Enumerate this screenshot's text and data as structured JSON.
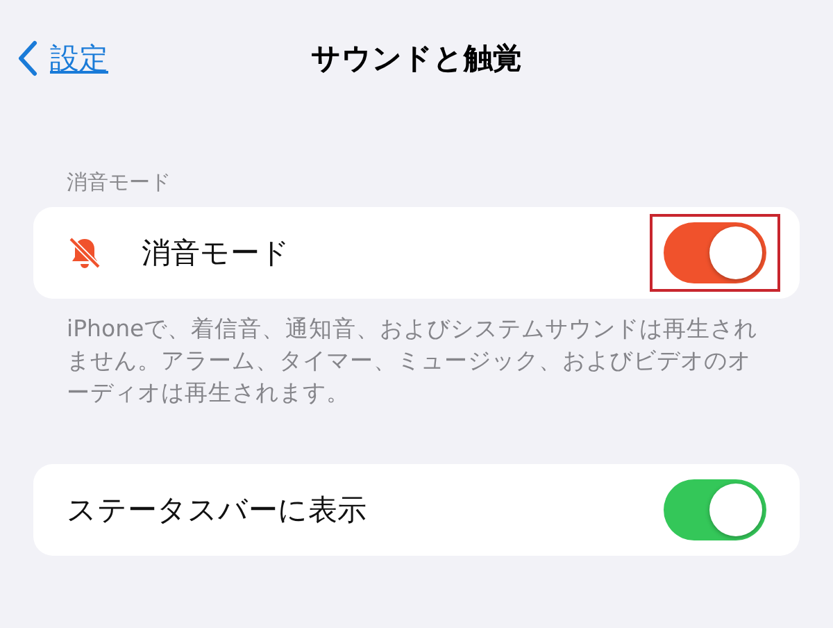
{
  "nav": {
    "back_label": "設定",
    "title": "サウンドと触覚"
  },
  "section_header": "消音モード",
  "rows": [
    {
      "label": "消音モード",
      "kind": "with-icon",
      "on": true,
      "color": "#f0522c",
      "highlighted": true,
      "footer": "iPhoneで、着信音、通知音、およびシステムサウンドは再生されません。アラーム、タイマー、ミュージック、およびビデオのオーディオは再生されます。"
    },
    {
      "label": "ステータスバーに表示",
      "kind": "plain",
      "on": true,
      "color": "#34c759",
      "highlighted": false
    }
  ]
}
